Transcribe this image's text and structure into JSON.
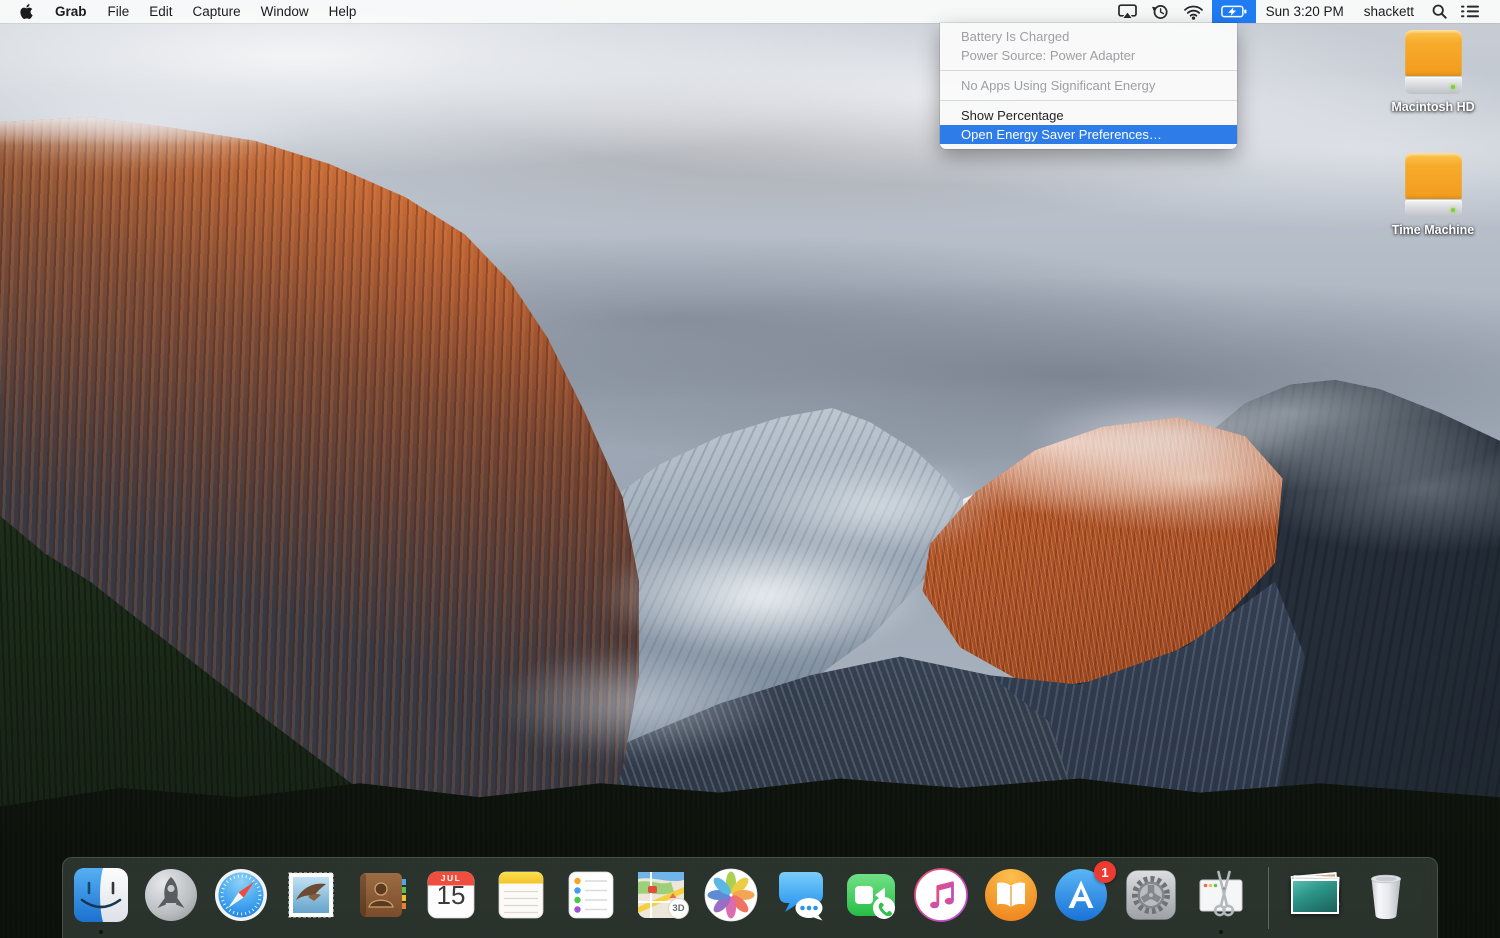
{
  "menu_bar": {
    "menus": [
      "Grab",
      "File",
      "Edit",
      "Capture",
      "Window",
      "Help"
    ],
    "clock": "Sun 3:20 PM",
    "user": "shackett"
  },
  "battery_menu": {
    "items": [
      {
        "label": "Battery Is Charged",
        "state": "disabled"
      },
      {
        "label": "Power Source: Power Adapter",
        "state": "disabled"
      },
      {
        "label": "No Apps Using Significant Energy",
        "state": "disabled"
      },
      {
        "label": "Show Percentage",
        "state": "enabled"
      },
      {
        "label": "Open Energy Saver Preferences…",
        "state": "highlighted"
      }
    ]
  },
  "desktop_icons": [
    {
      "label": "Macintosh HD",
      "icon": "orange-external-drive"
    },
    {
      "label": "Time Machine",
      "icon": "orange-external-drive"
    }
  ],
  "dock": {
    "items": [
      "finder",
      "launchpad",
      "safari",
      "mail",
      "contacts",
      "calendar",
      "notes",
      "reminders",
      "maps",
      "photos",
      "messages",
      "facetime",
      "itunes",
      "ibooks",
      "app-store",
      "system-preferences",
      "grab",
      "separator",
      "desktop-pictures-stack",
      "trash"
    ],
    "running_apps": [
      "finder",
      "grab"
    ],
    "calendar": {
      "month": "JUL",
      "day": "15"
    },
    "maps_badge": "3D",
    "app_store_badge": "1"
  },
  "colors": {
    "menubar_selection_blue": "#1f7cf3",
    "menu_item_highlight_blue": "#2e7ce8",
    "badge_red": "#ec3c31",
    "drive_orange": "#f5a82a",
    "dock_background": "rgba(68,78,73,0.55)"
  }
}
